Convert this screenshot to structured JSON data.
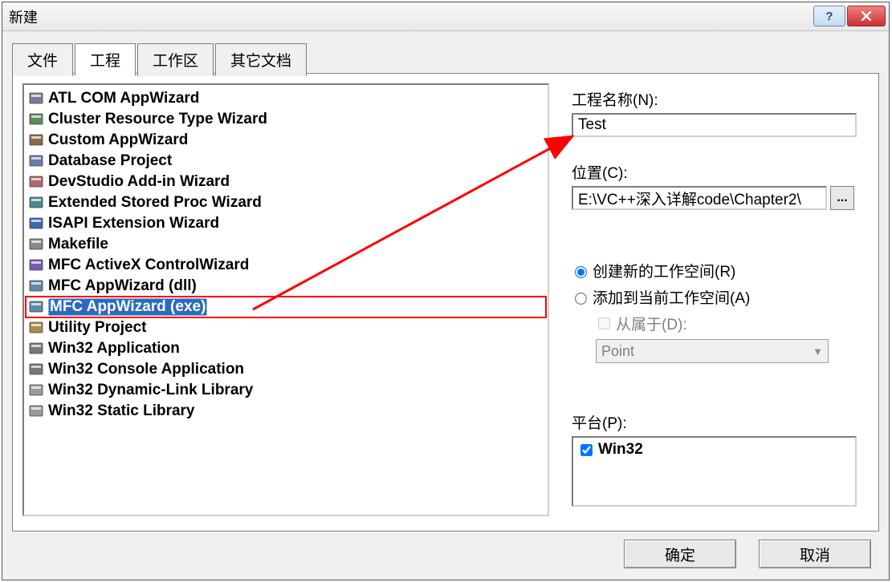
{
  "title": "新建",
  "tabs": [
    "文件",
    "工程",
    "工作区",
    "其它文档"
  ],
  "active_tab_index": 1,
  "project_types": [
    "ATL COM AppWizard",
    "Cluster Resource Type Wizard",
    "Custom AppWizard",
    "Database Project",
    "DevStudio Add-in Wizard",
    "Extended Stored Proc Wizard",
    "ISAPI Extension Wizard",
    "Makefile",
    "MFC ActiveX ControlWizard",
    "MFC AppWizard (dll)",
    "MFC AppWizard (exe)",
    "Utility Project",
    "Win32 Application",
    "Win32 Console Application",
    "Win32 Dynamic-Link Library",
    "Win32 Static Library"
  ],
  "selected_index": 10,
  "labels": {
    "name": "工程名称(N):",
    "location": "位置(C):",
    "create_ws": "创建新的工作空间(R)",
    "add_ws": "添加到当前工作空间(A)",
    "dep_of": "从属于(D):",
    "platform": "平台(P):",
    "browse": "..."
  },
  "fields": {
    "name": "Test",
    "location": "E:\\VC++深入详解code\\Chapter2\\",
    "workspace_radio": "create",
    "dep_enabled": false,
    "dep_combo": "Point",
    "platform_item": "Win32",
    "platform_checked": true
  },
  "buttons": {
    "ok": "确定",
    "cancel": "取消"
  }
}
